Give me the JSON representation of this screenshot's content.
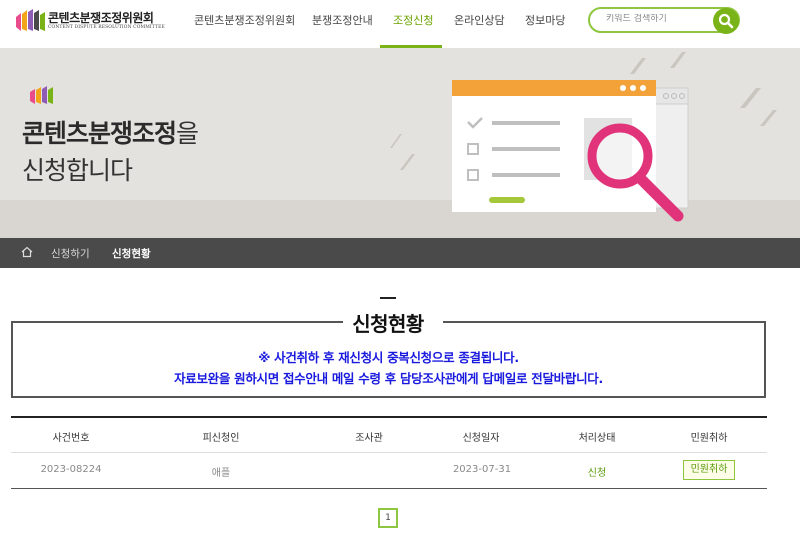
{
  "header": {
    "logo_title": "콘텐츠분쟁조정위원회",
    "logo_subtitle": "CONTENT DISPUTE RESOLUTION COMMITTEE",
    "nav": [
      {
        "label": "콘텐츠분쟁조정위원회",
        "active": false
      },
      {
        "label": "분쟁조정안내",
        "active": false
      },
      {
        "label": "조정신청",
        "active": true
      },
      {
        "label": "온라인상담",
        "active": false
      },
      {
        "label": "정보마당",
        "active": false
      }
    ],
    "search_placeholder": "키워드 검색하기",
    "accent_color": "#7ab317"
  },
  "hero": {
    "title_bold": "콘텐츠분쟁조정",
    "title_suffix": "을",
    "title_line2": "신청합니다"
  },
  "breadcrumb": {
    "items": [
      "신청하기",
      "신청현황"
    ]
  },
  "main": {
    "title": "신청현황",
    "notice_line1": "※ 사건취하 후 재신청시 중복신청으로 종결됩니다.",
    "notice_line2": "자료보완을 원하시면 접수안내 메일 수령 후 담당조사관에게 답메일로 전달바랍니다.",
    "notice_color": "#1a1adf"
  },
  "table": {
    "headers": [
      "사건번호",
      "피신청인",
      "조사관",
      "신청일자",
      "처리상태",
      "민원취하"
    ],
    "rows": [
      {
        "case_no": "2023-08224",
        "respondent": "애플",
        "investigator": "",
        "date": "2023-07-31",
        "status": "신청",
        "action": "민원취하"
      }
    ]
  },
  "pagination": {
    "current": "1"
  }
}
